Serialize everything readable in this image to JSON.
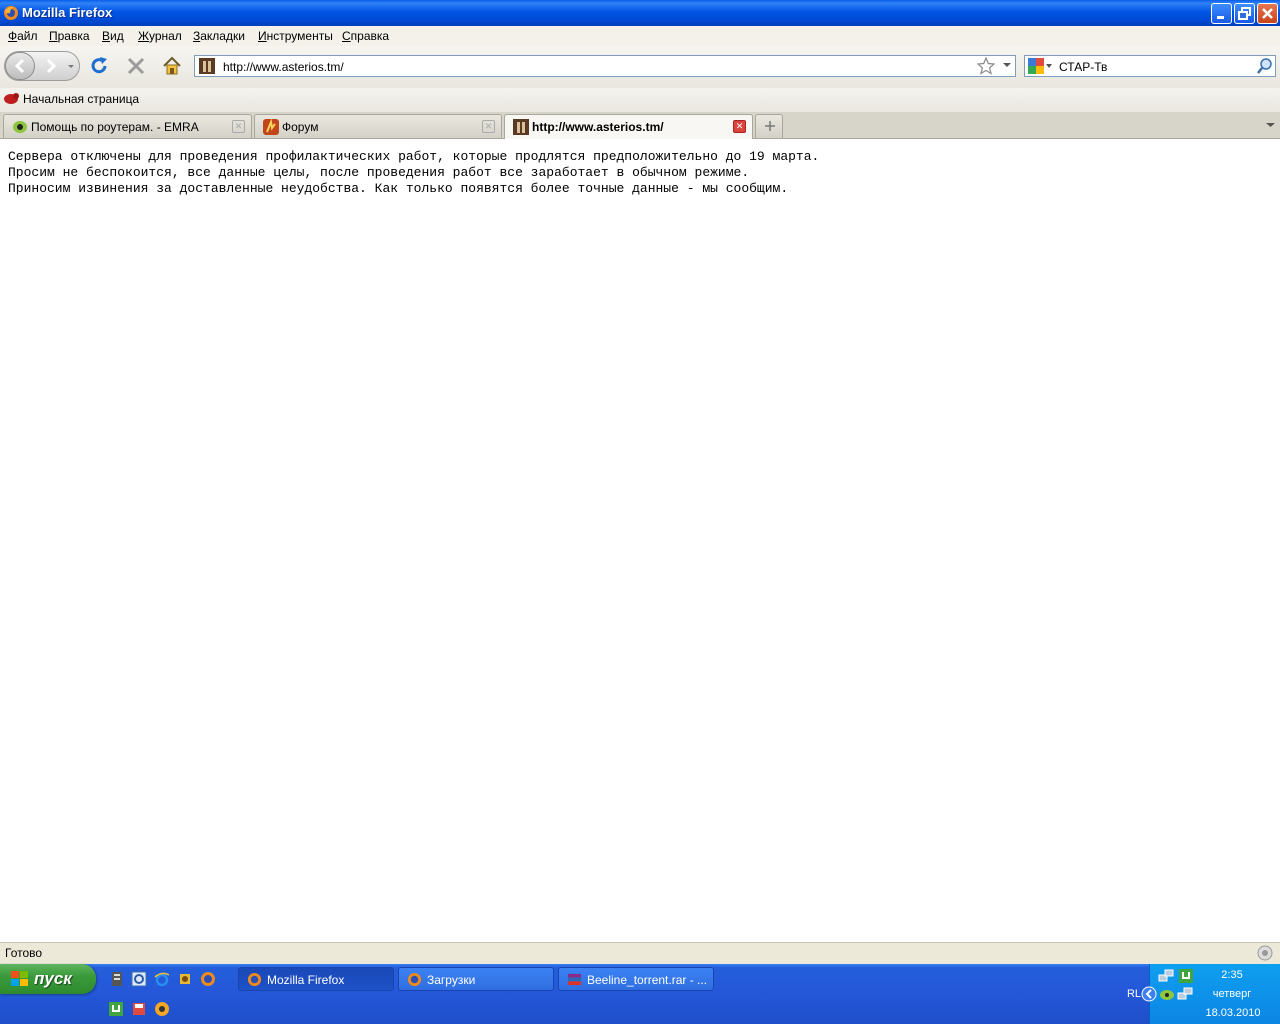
{
  "window": {
    "title": "Mozilla Firefox"
  },
  "menu": [
    "Файл",
    "Правка",
    "Вид",
    "Журнал",
    "Закладки",
    "Инструменты",
    "Справка"
  ],
  "navbar": {
    "url": "http://www.asterios.tm/",
    "search_text": "СТАР-Тв"
  },
  "bookmarks": {
    "home": "Начальная страница"
  },
  "tabs": [
    {
      "label": "Помощь по роутерам. - EMRA"
    },
    {
      "label": "Форум"
    },
    {
      "label": "http://www.asterios.tm/"
    }
  ],
  "content": {
    "lines": [
      "Сервера отключены для проведения профилактических работ, которые продлятся предположительно до 19 марта.",
      "Просим не беспокоится, все данные целы, после проведения работ все заработает в обычном режиме.",
      "Приносим извинения за доставленные неудобства. Как только появятся более точные данные - мы сообщим."
    ]
  },
  "status": {
    "text": "Готово"
  },
  "taskbar": {
    "start": "пуск",
    "tasks": [
      {
        "label": "Mozilla Firefox"
      },
      {
        "label": "Загрузки"
      },
      {
        "label": "Beeline_torrent.rar - ..."
      }
    ],
    "tray": {
      "lang": "RL",
      "time": "2:35",
      "day": "четверг",
      "date": "18.03.2010"
    }
  },
  "colors": {
    "titlebar": "#0055e5",
    "taskbar": "#245edb",
    "start": "#3a9a3a",
    "tray": "#0f9ff0"
  }
}
